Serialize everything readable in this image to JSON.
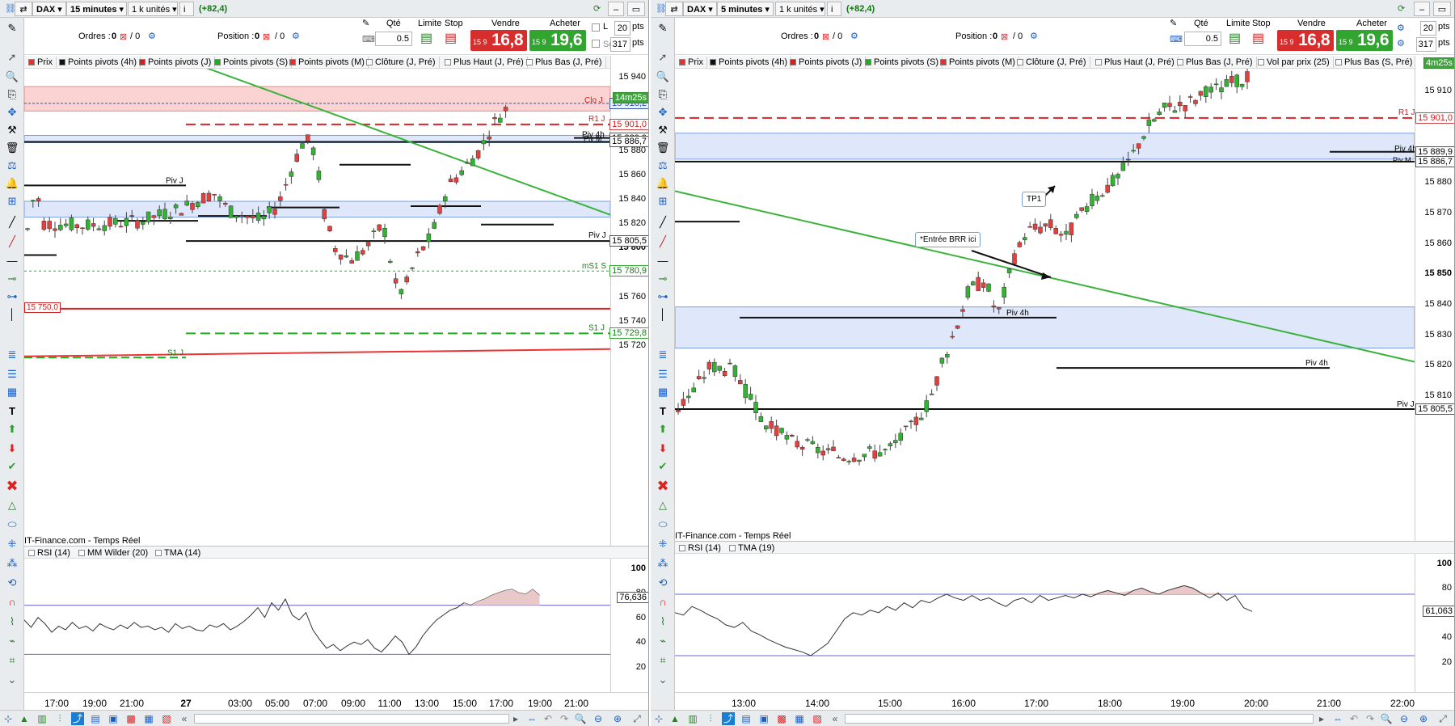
{
  "left": {
    "instrument": "DAX",
    "timeframe": "15 minutes",
    "units": "1 k unités",
    "pnl": "(+82,4)",
    "orders_label": "Ordres :",
    "orders_count": "0",
    "orders_sep": "/ 0",
    "position_label": "Position :",
    "position_count": "0",
    "position_sep": "/ 0",
    "qty_label": "Qté",
    "qty_value": "0.5",
    "limit_label": "Limite",
    "stop_label": "Stop",
    "sell_label": "Vendre",
    "buy_label": "Acheter",
    "sell_small": "15 9",
    "sell_big": "16,8",
    "buy_small": "15 9",
    "buy_big": "19,6",
    "pts1": "20",
    "pts2": "317",
    "pts_unit": "pts",
    "chk_l": "L",
    "chk_sg": "Sg",
    "legend": [
      "Prix",
      "Points pivots (4h)",
      "Points pivots (J)",
      "Points pivots (S)",
      "Points pivots (M)",
      "Clôture (J, Pré)",
      "Plus Haut (J, Pré)",
      "Plus Bas (J, Pré)"
    ],
    "price_axis": [
      "15 940",
      "15 920",
      "15 900",
      "15 880",
      "15 860",
      "15 840",
      "15 820",
      "15 800",
      "15 780",
      "15 760",
      "15 740",
      "15 720"
    ],
    "price_tags": {
      "last": "15 918,2",
      "timer": "14m25s",
      "r1": "15 901,0",
      "piv4h": "15 889,9",
      "pivm": "15 886,7",
      "pivj": "15 805,5",
      "ms1": "15 780,9",
      "s1": "15 729,8",
      "order": "15 750,0"
    },
    "plot_labels": {
      "clo": "Clo J",
      "r1": "R1 J",
      "piv4h": "Piv 4h",
      "pivm": "Piv M",
      "pivj_left": "Piv J",
      "pivj_right": "Piv J",
      "ms1": "mS1 S",
      "s1j": "S1 J",
      "s1": "S1 J"
    },
    "source": "IT-Finance.com - Temps Réel",
    "rsi_legend": [
      "RSI (14)",
      "MM Wilder (20)",
      "TMA (14)"
    ],
    "rsi_axis": [
      "100",
      "80",
      "60",
      "40",
      "20"
    ],
    "rsi_value": "76,636",
    "time_axis": [
      "17:00",
      "19:00",
      "21:00",
      "27",
      "03:00",
      "05:00",
      "07:00",
      "09:00",
      "11:00",
      "13:00",
      "15:00",
      "17:00",
      "19:00",
      "21:00"
    ]
  },
  "right": {
    "instrument": "DAX",
    "timeframe": "5 minutes",
    "units": "1 k unités",
    "pnl": "(+82,4)",
    "orders_label": "Ordres :",
    "orders_count": "0",
    "orders_sep": "/ 0",
    "position_label": "Position :",
    "position_count": "0",
    "position_sep": "/ 0",
    "qty_label": "Qté",
    "qty_value": "0.5",
    "limit_label": "Limite",
    "stop_label": "Stop",
    "sell_label": "Vendre",
    "buy_label": "Acheter",
    "sell_small": "15 9",
    "sell_big": "16,8",
    "buy_small": "15 9",
    "buy_big": "19,6",
    "pts1": "20",
    "pts2": "317",
    "pts_unit": "pts",
    "legend": [
      "Prix",
      "Points pivots (4h)",
      "Points pivots (J)",
      "Points pivots (S)",
      "Points pivots (M)",
      "Clôture (J, Pré)",
      "Plus Haut (J, Pré)",
      "Plus Bas (J, Pré)",
      "Vol par prix (25)",
      "Plus Bas (S, Pré)"
    ],
    "timer": "4m25s",
    "price_axis": [
      "15 910",
      "15 890",
      "15 880",
      "15 870",
      "15 860",
      "15 850",
      "15 840",
      "15 830",
      "15 820",
      "15 810"
    ],
    "price_tags": {
      "r1": "15 901,0",
      "piv4h": "15 889,9",
      "pivm": "15 886,7",
      "pivj": "15 805,5"
    },
    "plot_labels": {
      "r1": "R1 J",
      "piv4h": "Piv 4h",
      "pivm": "Piv M",
      "piv4h_mid": "Piv 4h",
      "piv4h_low": "Piv 4h",
      "pivj": "Piv J"
    },
    "annotations": {
      "tp1": "TP1",
      "entry": "*Entrée BRR ici"
    },
    "source": "IT-Finance.com - Temps Réel",
    "rsi_legend": [
      "RSI (14)",
      "TMA (19)"
    ],
    "rsi_axis": [
      "100",
      "80",
      "60",
      "40",
      "20"
    ],
    "rsi_value": "61,063",
    "time_axis": [
      "13:00",
      "14:00",
      "15:00",
      "16:00",
      "17:00",
      "18:00",
      "19:00",
      "20:00",
      "21:00",
      "22:00"
    ]
  }
}
